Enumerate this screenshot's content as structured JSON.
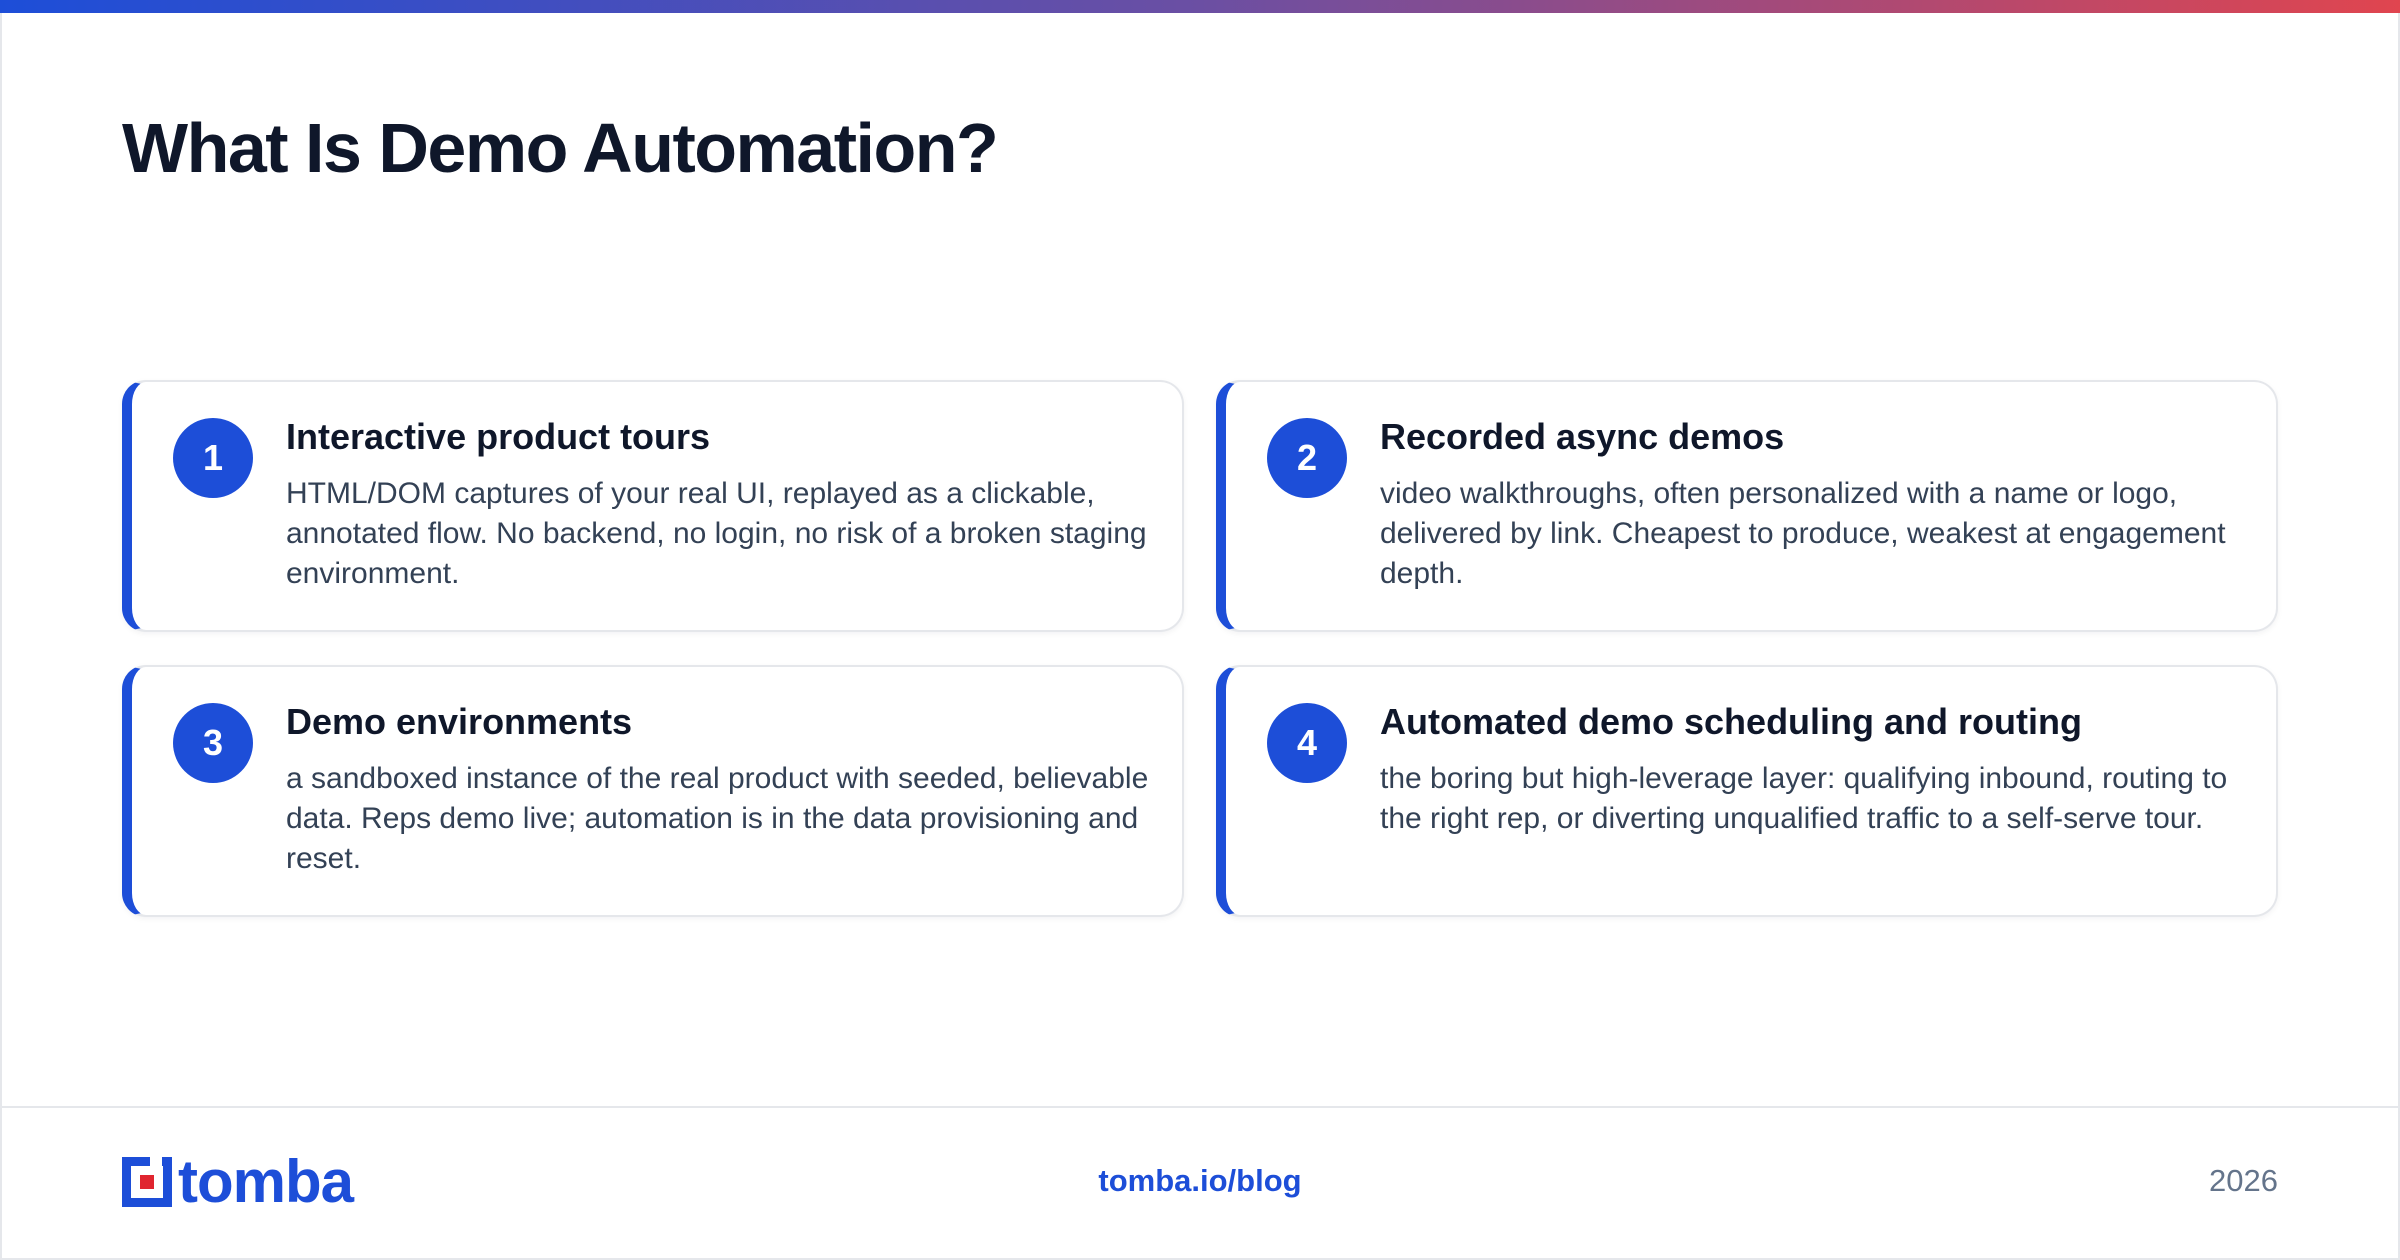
{
  "page": {
    "title": "What Is Demo Automation?"
  },
  "cards": [
    {
      "number": "1",
      "title": "Interactive product tours",
      "description": "HTML/DOM captures of your real UI, replayed as a clickable, annotated flow. No backend, no login, no risk of a broken staging environment."
    },
    {
      "number": "2",
      "title": "Recorded async demos",
      "description": "video walkthroughs, often personalized with a name or logo, delivered by link. Cheapest to produce, weakest at engagement depth."
    },
    {
      "number": "3",
      "title": "Demo environments",
      "description": "a sandboxed instance of the real product with seeded, believable data. Reps demo live; automation is in the data provisioning and reset."
    },
    {
      "number": "4",
      "title": "Automated demo scheduling and routing",
      "description": "the boring but high-leverage layer: qualifying inbound, routing to the right rep, or diverting unqualified traffic to a self-serve tour."
    }
  ],
  "footer": {
    "logo_text": "tomba",
    "link": "tomba.io/blog",
    "year": "2026"
  },
  "colors": {
    "accent": "#1d4ed8",
    "logo_red": "#e0252f",
    "gradient_start": "#1d4ed8",
    "gradient_end": "#e0454f"
  }
}
